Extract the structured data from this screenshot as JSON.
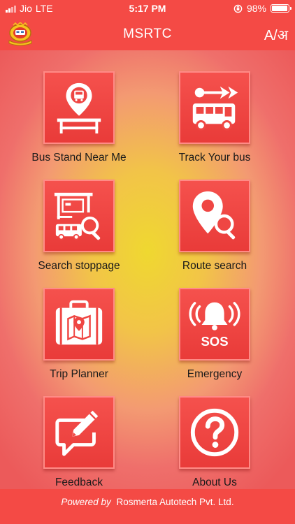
{
  "status_bar": {
    "carrier": "Jio",
    "network": "LTE",
    "time": "5:17 PM",
    "battery": "98%"
  },
  "header": {
    "title": "MSRTC",
    "lang_toggle": "A/अ"
  },
  "menu": {
    "items": [
      {
        "label": "Bus Stand Near Me",
        "icon": "bus-stand-location-icon"
      },
      {
        "label": "Track Your bus",
        "icon": "bus-track-icon"
      },
      {
        "label": "Search stoppage",
        "icon": "stoppage-search-icon"
      },
      {
        "label": "Route search",
        "icon": "route-search-icon"
      },
      {
        "label": "Trip Planner",
        "icon": "suitcase-map-icon"
      },
      {
        "label": "Emergency",
        "icon": "sos-alarm-icon"
      },
      {
        "label": "Feedback",
        "icon": "feedback-pencil-icon"
      },
      {
        "label": "About Us",
        "icon": "question-icon"
      }
    ],
    "sos_text": "SOS"
  },
  "footer": {
    "powered_by": "Powered by",
    "company": "Rosmerta Autotech Pvt. Ltd."
  },
  "colors": {
    "primary": "#f44a45",
    "tile": "#ef4643"
  }
}
